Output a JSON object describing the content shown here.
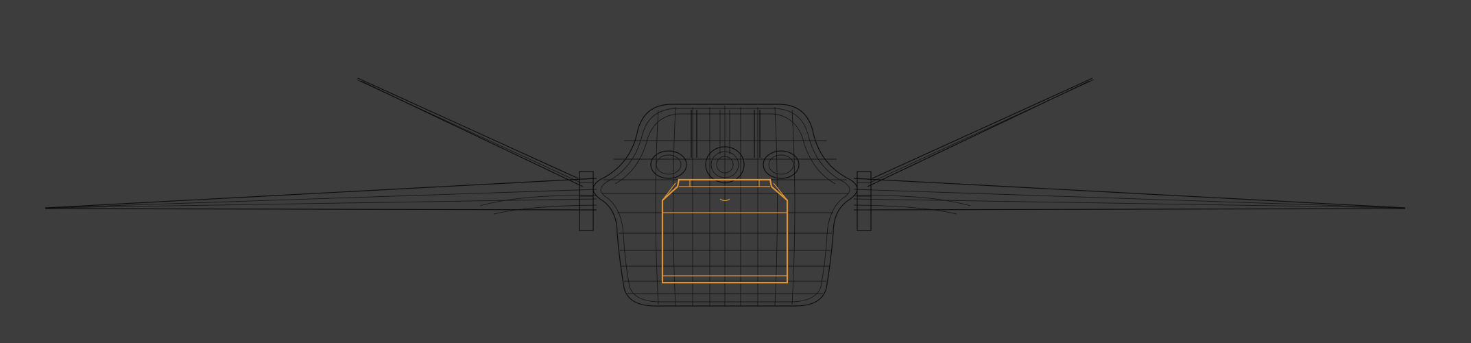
{
  "viewport": {
    "background_color": "#3d3d3d",
    "wire_color": "#0a0a0a",
    "selection_color": "#e69a3a",
    "mode": "wireframe"
  }
}
